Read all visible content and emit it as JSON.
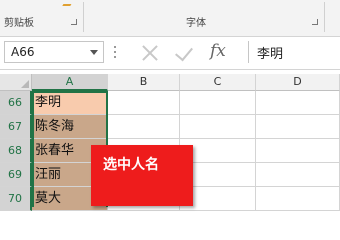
{
  "ribbon": {
    "clipboard_label": "剪贴板",
    "font_label": "字体"
  },
  "formula_bar": {
    "name_box": "A66",
    "fx_label": "fx",
    "formula_value": "李明"
  },
  "grid": {
    "columns": [
      "A",
      "B",
      "C",
      "D"
    ],
    "selected_column": "A",
    "rows": [
      {
        "num": "66",
        "a": "李明",
        "fill": "#f8cbad"
      },
      {
        "num": "67",
        "a": "陈冬海",
        "fill": "#c9a78a"
      },
      {
        "num": "68",
        "a": "张春华",
        "fill": "#c9a78a"
      },
      {
        "num": "69",
        "a": "汪丽",
        "fill": "#c9a78a"
      },
      {
        "num": "70",
        "a": "莫大",
        "fill": "#c9a78a"
      }
    ]
  },
  "annotation": {
    "text": "选中人名",
    "color": "#ee1c1c"
  }
}
